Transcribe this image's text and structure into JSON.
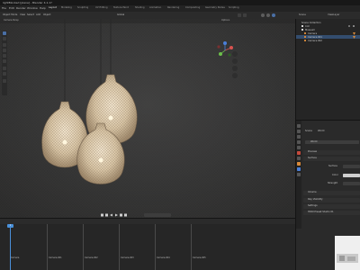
{
  "window": {
    "title": "lightBlocked [plane] - Blender 4.1.1?"
  },
  "menubar": {
    "items": [
      "File",
      "Edit",
      "Render",
      "Window",
      "Help"
    ],
    "workspaces": [
      "Layout",
      "Modeling",
      "Sculpting",
      "UV Editing",
      "Texture Paint",
      "Shading",
      "Animation",
      "Rendering",
      "Compositing",
      "Geometry Nodes",
      "Scripting"
    ],
    "active_workspace": "Layout"
  },
  "viewport": {
    "header": {
      "mode": "Object Mode",
      "view": "View",
      "select": "Select",
      "add": "Add",
      "object": "Object",
      "orientation": "Global",
      "options_label": "Options"
    },
    "info_line": "Camera Persp"
  },
  "right_header": {
    "scene": "Scene",
    "view_layer": "ViewLayer"
  },
  "outliner": {
    "header": "Scene Collection",
    "rows": [
      {
        "label": "Scene Collection",
        "color": "#d0d0d0"
      },
      {
        "label": "Coll",
        "color": "#e0e0e0"
      },
      {
        "label": "Museum",
        "color": "#e0e0e0"
      },
      {
        "label": "Camera",
        "color": "#d88a3a"
      },
      {
        "label": "Camera.001",
        "color": "#d88a3a"
      },
      {
        "label": "Camera.002",
        "color": "#d88a3a"
      }
    ]
  },
  "properties": {
    "breadcrumb_a": "Scene",
    "breadcrumb_b": "World",
    "world_name": "World",
    "sections": {
      "preview": "Preview",
      "surface": "Surface",
      "volume": "Volume",
      "ray_visibility": "Ray Visibility",
      "settings": "Settings",
      "viewport_display": "HDRI Preset Studio 01"
    },
    "fields": {
      "surface_label": "Surface",
      "color_label": "Color",
      "strength_label": "Strength"
    }
  },
  "timeline": {
    "current_frame": "1",
    "markers": [
      "Camera",
      "Camera.001",
      "Camera.002",
      "Camera.003",
      "Camera.004",
      "Camera.005",
      "Camera.006"
    ]
  }
}
